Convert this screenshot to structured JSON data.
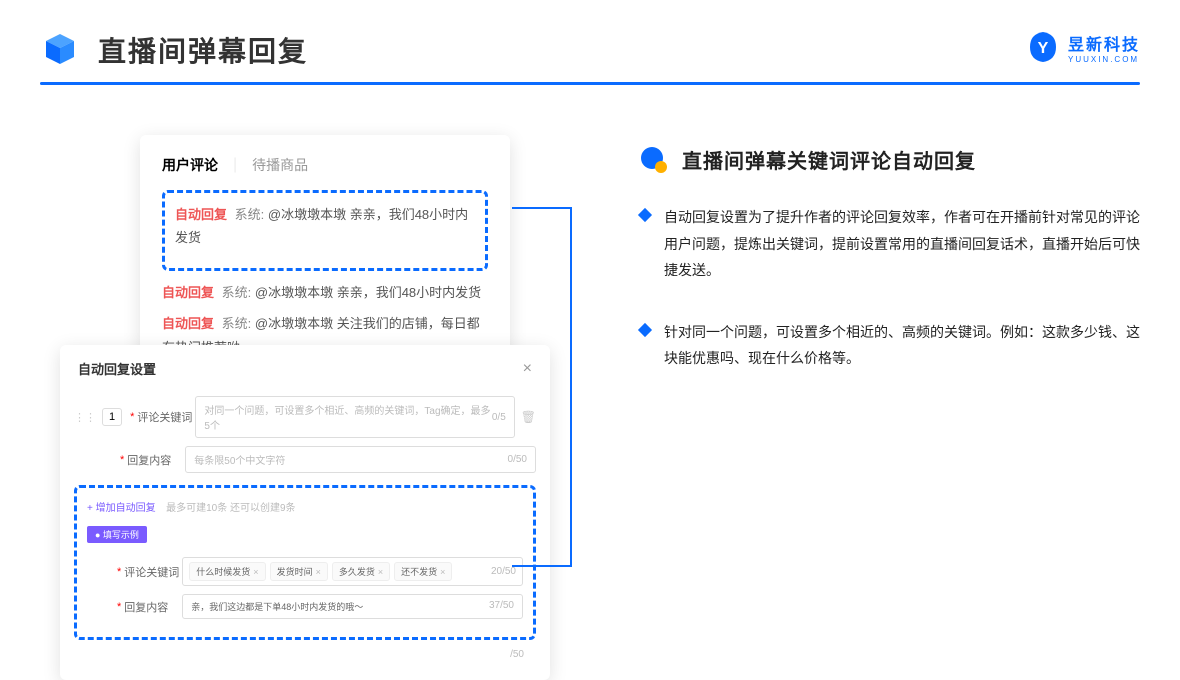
{
  "header": {
    "title": "直播间弹幕回复"
  },
  "brand": {
    "name": "昱新科技",
    "sub": "YUUXIN.COM"
  },
  "tabs": {
    "a": "用户评论",
    "b": "待播商品"
  },
  "comments": {
    "auto_label": "自动回复",
    "sys_label": "系统:",
    "c1": "@冰墩墩本墩 亲亲，我们48小时内发货",
    "c2": "@冰墩墩本墩 亲亲，我们48小时内发货",
    "c3": "@冰墩墩本墩 关注我们的店铺，每日都有热门推荐呦～"
  },
  "settings": {
    "title": "自动回复设置",
    "idx": "1",
    "kw_label": "评论关键词",
    "kw_ph": "对同一个问题，可设置多个相近、高频的关键词，Tag确定，最多5个",
    "kw_count": "0/5",
    "content_label": "回复内容",
    "content_ph": "每条限50个中文字符",
    "content_count": "0/50",
    "add_label": "+ 增加自动回复",
    "add_hint": "最多可建10条 还可以创建9条",
    "example_badge": "● 填写示例",
    "ex_kw_label": "评论关键词",
    "tags": [
      "什么时候发货",
      "发货时间",
      "多久发货",
      "还不发货"
    ],
    "ex_kw_count": "20/50",
    "ex_content_label": "回复内容",
    "ex_content": "亲，我们这边都是下单48小时内发货的哦～",
    "ex_content_count": "37/50",
    "outer_count": "/50"
  },
  "right": {
    "section_title": "直播间弹幕关键词评论自动回复",
    "b1": "自动回复设置为了提升作者的评论回复效率，作者可在开播前针对常见的评论用户问题，提炼出关键词，提前设置常用的直播间回复话术，直播开始后可快捷发送。",
    "b2": "针对同一个问题，可设置多个相近的、高频的关键词。例如：这款多少钱、这块能优惠吗、现在什么价格等。"
  }
}
